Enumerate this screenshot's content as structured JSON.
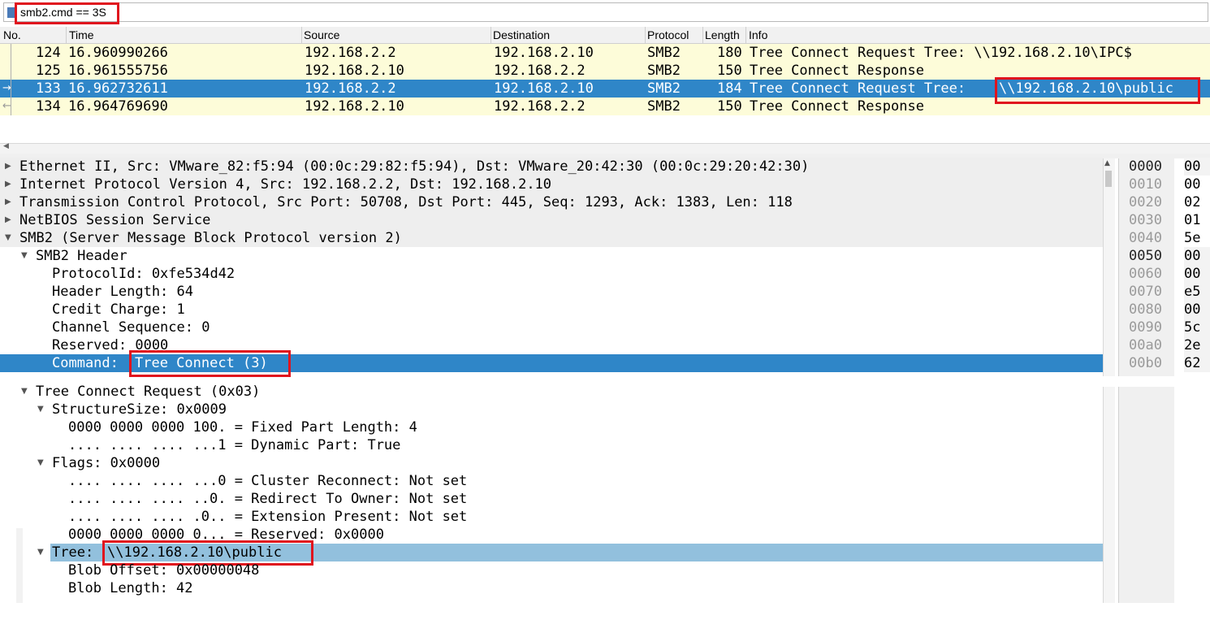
{
  "filter": {
    "value": "smb2.cmd == 3S",
    "icon": "bookmark-icon"
  },
  "packet_list": {
    "columns": [
      "No.",
      "Time",
      "Source",
      "Destination",
      "Protocol",
      "Length",
      "Info"
    ],
    "rows": [
      {
        "no": "124",
        "time": "16.960990266",
        "src": "192.168.2.2",
        "dst": "192.168.2.10",
        "proto": "SMB2",
        "len": "180",
        "info": "Tree Connect Request Tree: \\\\192.168.2.10\\IPC$",
        "info_prefix": "",
        "info_tree": "",
        "marker": ""
      },
      {
        "no": "125",
        "time": "16.961555756",
        "src": "192.168.2.10",
        "dst": "192.168.2.2",
        "proto": "SMB2",
        "len": "150",
        "info": "Tree Connect Response",
        "info_prefix": "",
        "info_tree": "",
        "marker": ""
      },
      {
        "no": "133",
        "time": "16.962732611",
        "src": "192.168.2.2",
        "dst": "192.168.2.10",
        "proto": "SMB2",
        "len": "184",
        "info": "",
        "info_prefix": "Tree Connect Request Tree: ",
        "info_tree": "\\\\192.168.2.10\\public",
        "marker": "→"
      },
      {
        "no": "134",
        "time": "16.964769690",
        "src": "192.168.2.10",
        "dst": "192.168.2.2",
        "proto": "SMB2",
        "len": "150",
        "info": "Tree Connect Response",
        "info_prefix": "",
        "info_tree": "",
        "marker": "←"
      }
    ]
  },
  "details": {
    "ethernet": "Ethernet II, Src: VMware_82:f5:94 (00:0c:29:82:f5:94), Dst: VMware_20:42:30 (00:0c:29:20:42:30)",
    "ip": "Internet Protocol Version 4, Src: 192.168.2.2, Dst: 192.168.2.10",
    "tcp": "Transmission Control Protocol, Src Port: 50708, Dst Port: 445, Seq: 1293, Ack: 1383, Len: 118",
    "netbios": "NetBIOS Session Service",
    "smb2": "SMB2 (Server Message Block Protocol version 2)",
    "smb2_header": "SMB2 Header",
    "protocol_id": "ProtocolId: 0xfe534d42",
    "header_length": "Header Length: 64",
    "credit_charge": "Credit Charge: 1",
    "channel_sequence": "Channel Sequence: 0",
    "reserved": "Reserved: 0000",
    "command_label": "Command: ",
    "command_value": "Tree Connect (3)",
    "tree_connect_request": "Tree Connect Request (0x03)",
    "structure_size": "StructureSize: 0x0009",
    "fixed_part": "0000 0000 0000 100. = Fixed Part Length: 4",
    "dynamic_part": ".... .... .... ...1 = Dynamic Part: True",
    "flags": "Flags: 0x0000",
    "cluster_reconnect": ".... .... .... ...0 = Cluster Reconnect: Not set",
    "redirect_owner": ".... .... .... ..0. = Redirect To Owner: Not set",
    "extension_present": ".... .... .... .0.. = Extension Present: Not set",
    "reserved_flags": "0000 0000 0000 0... = Reserved: 0x0000",
    "tree_label": "Tree: ",
    "tree_value": "\\\\192.168.2.10\\public",
    "blob_offset": "Blob Offset: 0x00000048",
    "blob_length": "Blob Length: 42"
  },
  "hex": {
    "offsets": [
      "0000",
      "0010",
      "0020",
      "0030",
      "0040",
      "0050",
      "0060",
      "0070",
      "0080",
      "0090",
      "00a0",
      "00b0"
    ],
    "values": [
      "00",
      "00",
      "02",
      "01",
      "5e",
      "00",
      "00",
      "e5",
      "00",
      "5c",
      "2e",
      "62"
    ],
    "current_offsets": [
      "0000",
      "0050"
    ]
  },
  "colors": {
    "selected": "#2f86c8",
    "selected_pale": "#92c0dd",
    "highlight_box": "#e0141e",
    "row_yellow": "#fdfcd9"
  }
}
